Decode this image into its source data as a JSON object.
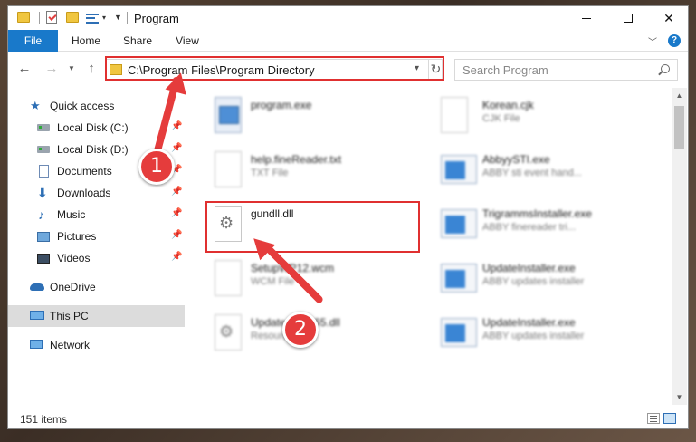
{
  "window": {
    "title": "Program",
    "ribbon_tabs": [
      "File",
      "Home",
      "Share",
      "View"
    ],
    "controls": {
      "minimize": "—",
      "maximize": "☐",
      "close": "✕"
    }
  },
  "navigation": {
    "back_icon": "arrow-left-icon",
    "forward_icon": "arrow-right-icon",
    "recent_icon": "chevron-down-icon",
    "up_icon": "arrow-up-icon",
    "address_path": "C:\\Program Files\\Program Directory",
    "refresh_icon": "refresh-icon",
    "search_placeholder": "Search Program"
  },
  "sidebar": {
    "items": [
      {
        "label": "Quick access",
        "icon": "star-icon",
        "pinned": false
      },
      {
        "label": "Local Disk (C:)",
        "icon": "drive-icon",
        "pinned": true
      },
      {
        "label": "Local Disk (D:)",
        "icon": "drive-icon",
        "pinned": true
      },
      {
        "label": "Documents",
        "icon": "document-icon",
        "pinned": true
      },
      {
        "label": "Downloads",
        "icon": "download-icon",
        "pinned": true
      },
      {
        "label": "Music",
        "icon": "music-icon",
        "pinned": true
      },
      {
        "label": "Pictures",
        "icon": "picture-icon",
        "pinned": true
      },
      {
        "label": "Videos",
        "icon": "video-icon",
        "pinned": true
      },
      {
        "label": "OneDrive",
        "icon": "cloud-icon",
        "pinned": false
      },
      {
        "label": "This PC",
        "icon": "computer-icon",
        "pinned": false,
        "selected": true
      },
      {
        "label": "Network",
        "icon": "network-icon",
        "pinned": false
      }
    ]
  },
  "files": {
    "left": [
      {
        "name": "program.exe",
        "type": "",
        "blurred": true
      },
      {
        "name": "help.fineReader.txt",
        "type": "TXT File",
        "blurred": true
      },
      {
        "name": "gundll.dll",
        "type": "",
        "blurred": false,
        "highlighted": true
      },
      {
        "name": "SetupWP12.wcm",
        "type": "WCM File",
        "blurred": true
      },
      {
        "name": "UpdateAgent65.dll",
        "type": "Resources",
        "blurred": true
      }
    ],
    "right": [
      {
        "name": "Korean.cjk",
        "type": "CJK File",
        "blurred": true
      },
      {
        "name": "AbbyySTI.exe",
        "type": "ABBY sti event hand...",
        "blurred": true
      },
      {
        "name": "TrigrammsInstaller.exe",
        "type": "ABBY finereader tri...",
        "blurred": true
      },
      {
        "name": "UpdateInstaller.exe",
        "type": "ABBY updates installer",
        "blurred": true
      },
      {
        "name": "UpdateInstaller.exe",
        "type": "ABBY updates installer",
        "blurred": true
      }
    ]
  },
  "callouts": {
    "step1": "1",
    "step2": "2",
    "color": "#e53c3c"
  },
  "status": {
    "item_count": "151 items"
  },
  "colors": {
    "accent": "#1979ca",
    "highlight_border": "#e03030"
  }
}
